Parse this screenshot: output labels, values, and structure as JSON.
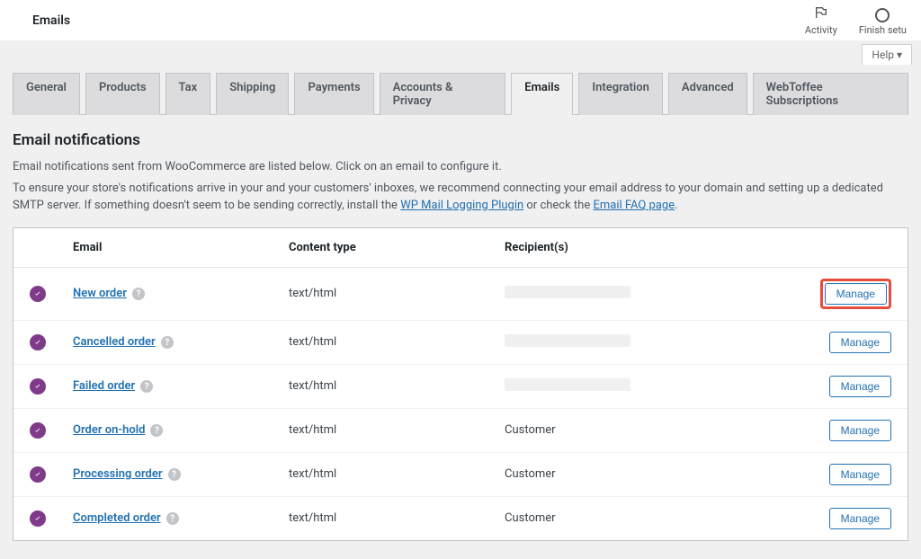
{
  "topbar": {
    "title": "Emails",
    "activity_label": "Activity",
    "finish_label": "Finish setu"
  },
  "help": {
    "label": "Help ▾"
  },
  "tabs": [
    {
      "label": "General",
      "active": false
    },
    {
      "label": "Products",
      "active": false
    },
    {
      "label": "Tax",
      "active": false
    },
    {
      "label": "Shipping",
      "active": false
    },
    {
      "label": "Payments",
      "active": false
    },
    {
      "label": "Accounts & Privacy",
      "active": false
    },
    {
      "label": "Emails",
      "active": true
    },
    {
      "label": "Integration",
      "active": false
    },
    {
      "label": "Advanced",
      "active": false
    },
    {
      "label": "WebToffee Subscriptions",
      "active": false
    }
  ],
  "section": {
    "heading": "Email notifications",
    "desc1": "Email notifications sent from WooCommerce are listed below. Click on an email to configure it.",
    "desc2_pre": "To ensure your store's notifications arrive in your and your customers' inboxes, we recommend connecting your email address to your domain and setting up a dedicated SMTP server. If something doesn't seem to be sending correctly, install the ",
    "desc2_link1": "WP Mail Logging Plugin",
    "desc2_mid": " or check the ",
    "desc2_link2": "Email FAQ page",
    "desc2_post": "."
  },
  "table": {
    "headers": {
      "email": "Email",
      "content_type": "Content type",
      "recipients": "Recipient(s)"
    },
    "manage_label": "Manage",
    "rows": [
      {
        "name": "New order",
        "ctype": "text/html",
        "recipient": "",
        "masked": true,
        "highlight": true
      },
      {
        "name": "Cancelled order",
        "ctype": "text/html",
        "recipient": "",
        "masked": true,
        "highlight": false
      },
      {
        "name": "Failed order",
        "ctype": "text/html",
        "recipient": "",
        "masked": true,
        "highlight": false
      },
      {
        "name": "Order on-hold",
        "ctype": "text/html",
        "recipient": "Customer",
        "masked": false,
        "highlight": false
      },
      {
        "name": "Processing order",
        "ctype": "text/html",
        "recipient": "Customer",
        "masked": false,
        "highlight": false
      },
      {
        "name": "Completed order",
        "ctype": "text/html",
        "recipient": "Customer",
        "masked": false,
        "highlight": false
      }
    ]
  }
}
